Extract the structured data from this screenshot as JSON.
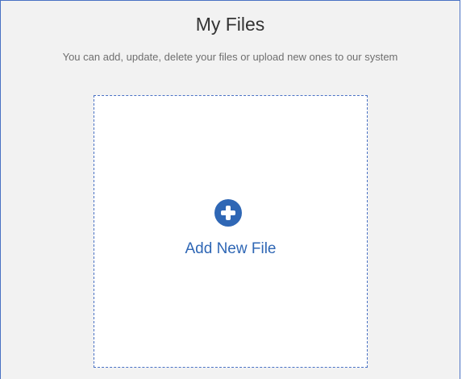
{
  "header": {
    "title": "My Files",
    "subtitle": "You can add, update, delete your files or upload new ones to our system"
  },
  "upload": {
    "label": "Add New File",
    "icon": "plus-circle-icon"
  },
  "colors": {
    "accent": "#2f67b5",
    "border": "#4a72c4",
    "background": "#f2f2f2",
    "dropzone_background": "#ffffff",
    "title_text": "#333333",
    "subtitle_text": "#6f6f6f"
  }
}
